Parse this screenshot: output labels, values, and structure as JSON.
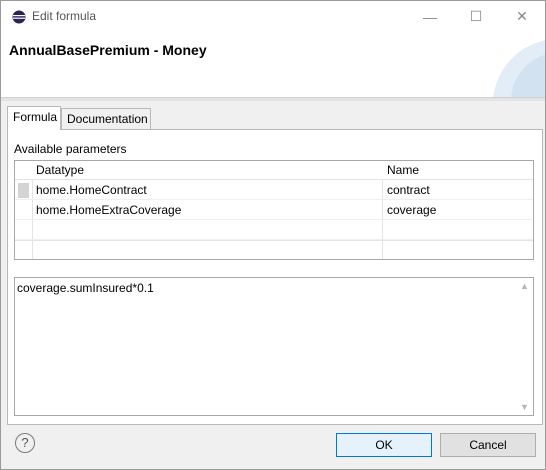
{
  "window": {
    "title": "Edit formula",
    "controls": {
      "minimize": "—",
      "maximize": "☐",
      "close": "✕"
    }
  },
  "header": {
    "title": "AnnualBasePremium - Money"
  },
  "tabs": [
    {
      "label": "Formula",
      "active": true
    },
    {
      "label": "Documentation",
      "active": false
    }
  ],
  "parameters": {
    "label": "Available parameters",
    "columns": [
      "Datatype",
      "Name"
    ],
    "rows": [
      {
        "datatype": "home.HomeContract",
        "name": "contract"
      },
      {
        "datatype": "home.HomeExtraCoverage",
        "name": "coverage"
      }
    ]
  },
  "formula": {
    "text": "coverage.sumInsured*0.1"
  },
  "footer": {
    "help_icon": "?",
    "ok_label": "OK",
    "cancel_label": "Cancel"
  },
  "colors": {
    "accent": "#0078d7",
    "icon_purple": "#2c2255"
  }
}
